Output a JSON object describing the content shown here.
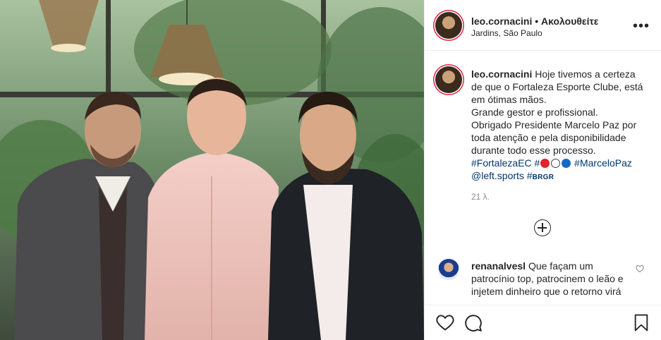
{
  "post": {
    "author": "leo.cornacini",
    "separator": "•",
    "follow_label": "Ακολουθείτε",
    "location": "Jardins, São Paulo",
    "more_icon": "more-options-icon"
  },
  "caption": {
    "author": "leo.cornacini",
    "text": "Hoje tivemos a certeza de que o Fortaleza Esporte Clube, está em ótimas mãos.\nGrande gestor e profissional.\nObrigado Presidente Marcelo Paz por toda atenção e pela disponibilidade durante todo esse processo.",
    "tag1": "#FortalezaEC",
    "tag2_prefix": "#",
    "tag3": "#MarceloPaz",
    "mention": "@left.sports",
    "tag4": "#",
    "brgr": "BRGR",
    "ball_colors": [
      "#e4202a",
      "#ffffff",
      "#1569c7"
    ],
    "age": "21 λ."
  },
  "load_more": {
    "icon": "plus-circle-icon"
  },
  "comment": {
    "author": "renanalvesl",
    "text": "Que façam um patrocínio top, patrocinem o leão e injetem dinheiro que o retorno virá"
  },
  "actions": {
    "like_icon": "heart-icon",
    "comment_icon": "comment-bubble-icon",
    "save_icon": "bookmark-icon"
  },
  "colors": {
    "link": "#00376b",
    "muted": "#8e8e8e",
    "border": "#efefef"
  }
}
